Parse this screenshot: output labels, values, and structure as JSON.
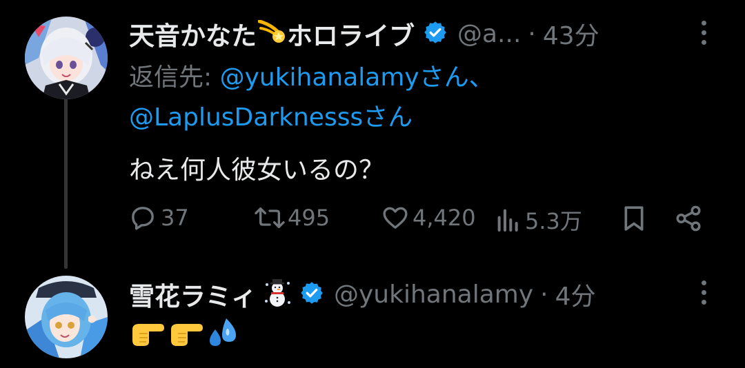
{
  "tweet1": {
    "name": "天音かなた",
    "name_emoji": "comet-emoji",
    "name_suffix": "ホロライブ",
    "handle": "@a...",
    "dot": "·",
    "time": "43分",
    "reply_prefix": "返信先: ",
    "reply_mention_1": "@yukihanalamyさん、",
    "reply_mention_2": "@LaplusDarknesssさん",
    "text": "ねえ何人彼女いるの？",
    "actions": {
      "replies": "37",
      "retweets": "495",
      "likes": "4,420",
      "views": "5.3万"
    }
  },
  "tweet2": {
    "name": "雪花ラミィ",
    "name_emoji": "snowman-emoji",
    "handle": "@yukihanalamy",
    "dot": "·",
    "time": "4分",
    "emojis": [
      "backhand-pointing-right-emoji",
      "backhand-pointing-right-emoji",
      "sweat-droplets-emoji"
    ]
  },
  "colors": {
    "background": "#000000",
    "text": "#e7e9ea",
    "muted": "#71767b",
    "accent": "#1d9bf0"
  }
}
